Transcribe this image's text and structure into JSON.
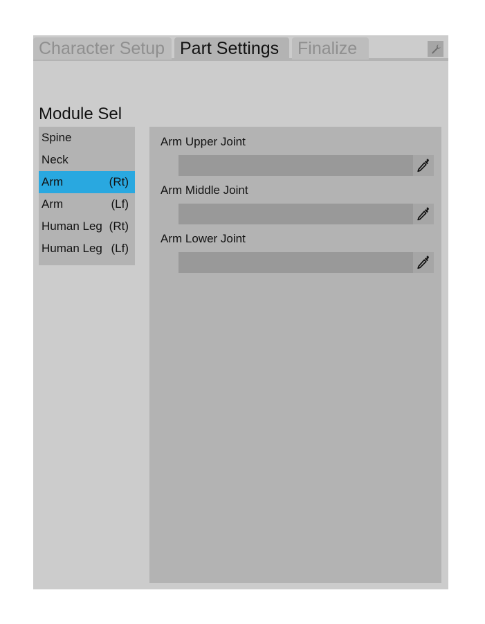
{
  "tabs": [
    {
      "label": "Character Setup"
    },
    {
      "label": "Part Settings"
    },
    {
      "label": "Finalize"
    }
  ],
  "active_tab": "Part Settings",
  "module_section": {
    "title": "Module Sel",
    "items": [
      {
        "name": "Spine",
        "side": ""
      },
      {
        "name": "Neck",
        "side": ""
      },
      {
        "name": "Arm",
        "side": "(Rt)"
      },
      {
        "name": "Arm",
        "side": "(Lf)"
      },
      {
        "name": "Human Leg",
        "side": "(Rt)"
      },
      {
        "name": "Human Leg",
        "side": "(Lf)"
      }
    ],
    "selected_index": 2
  },
  "settings": {
    "joints": [
      {
        "label": "Arm Upper Joint",
        "value": ""
      },
      {
        "label": "Arm Middle Joint",
        "value": ""
      },
      {
        "label": "Arm Lower Joint",
        "value": ""
      }
    ]
  },
  "icons": {
    "settings_button": "wrench-icon",
    "field_picker": "eyedropper-icon"
  },
  "colors": {
    "panel_bg": "#cccccc",
    "section_bg": "#b3b3b3",
    "field_bg": "#999999",
    "selection": "#29a8e0",
    "inactive_tab_text": "#8f8f8f"
  }
}
